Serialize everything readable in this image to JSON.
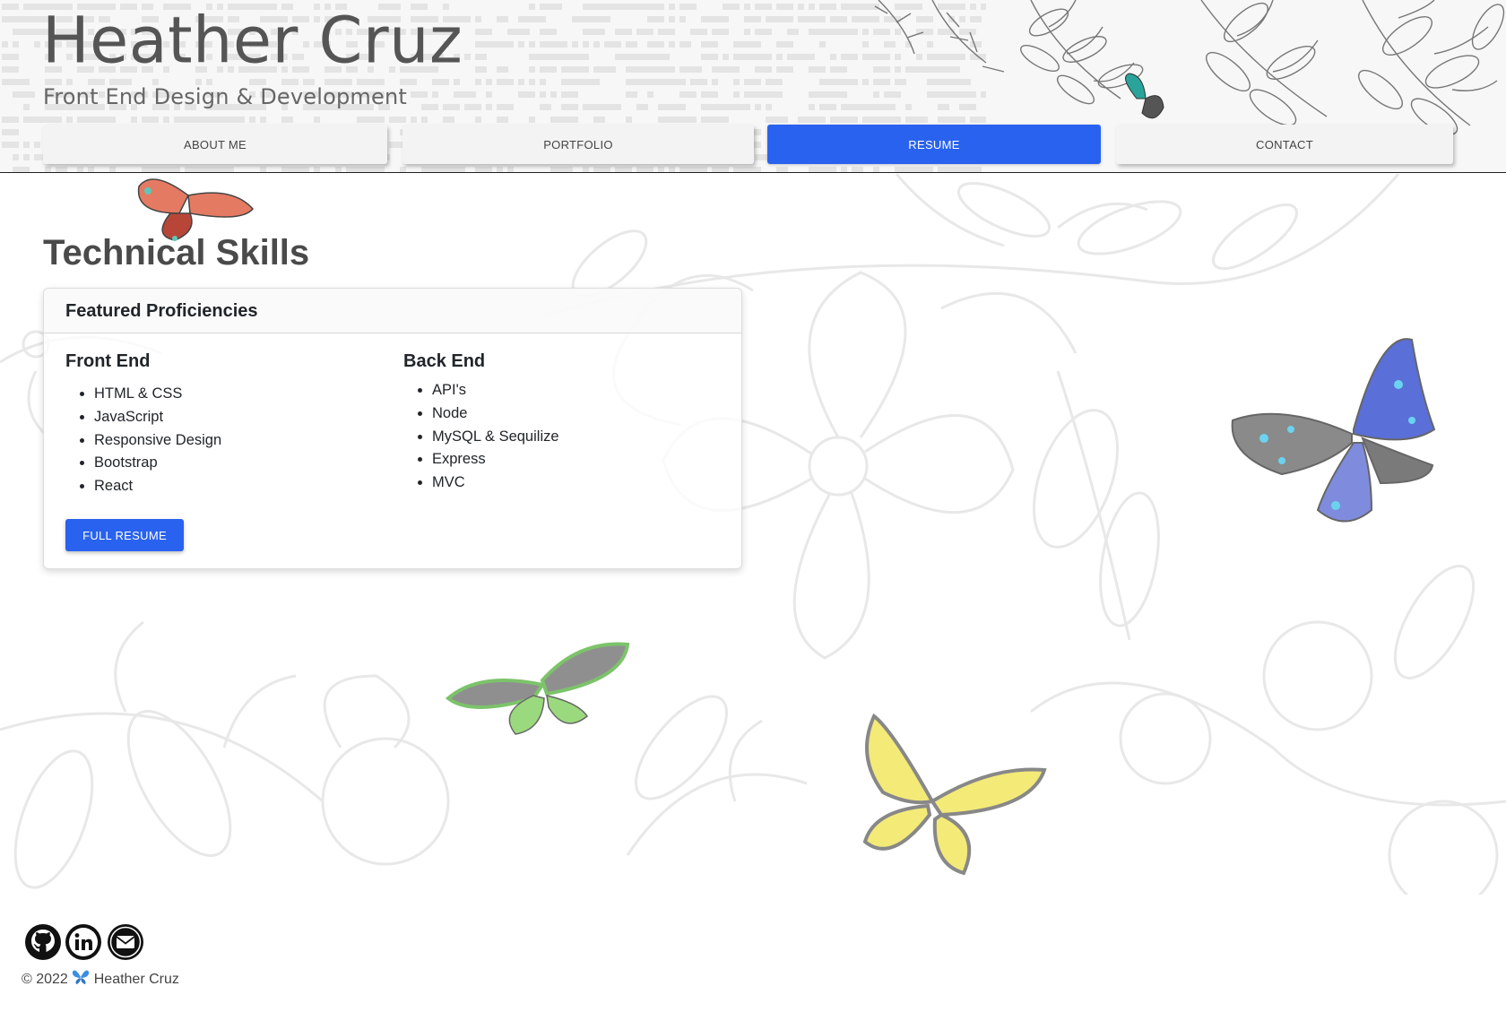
{
  "header": {
    "title": "Heather Cruz",
    "subtitle": "Front End Design & Development"
  },
  "nav": {
    "items": [
      {
        "label": "ABOUT ME"
      },
      {
        "label": "PORTFOLIO"
      },
      {
        "label": "RESUME",
        "active": true
      },
      {
        "label": "CONTACT"
      }
    ]
  },
  "main": {
    "section_title": "Technical Skills",
    "card": {
      "title": "Featured Proficiencies",
      "front_end": {
        "heading": "Front End",
        "items": [
          "HTML & CSS",
          "JavaScript",
          "Responsive Design",
          "Bootstrap",
          "React"
        ]
      },
      "back_end": {
        "heading": "Back End",
        "items": [
          "API's",
          "Node",
          "MySQL & Sequilize",
          "Express",
          "MVC"
        ]
      },
      "button_label": "FULL RESUME"
    }
  },
  "footer": {
    "social_icons": [
      "github-icon",
      "linkedin-icon",
      "email-icon"
    ],
    "copyright_prefix": "© 2022",
    "copyright_name": "Heather Cruz"
  },
  "colors": {
    "accent": "#2962ef",
    "title_text": "#555555",
    "nav_bg": "#f3f3f3"
  }
}
